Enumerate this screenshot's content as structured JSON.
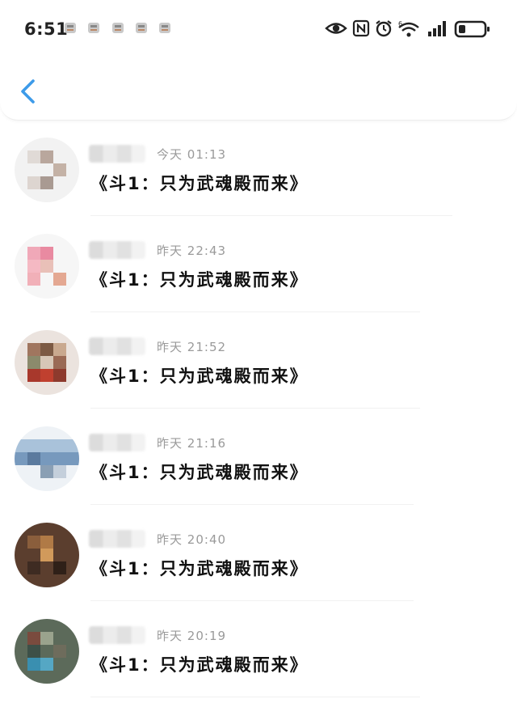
{
  "status_bar": {
    "time": "6:51",
    "notification_icons": [
      "app-icon",
      "app-icon",
      "app-icon",
      "app-icon",
      "app-icon"
    ],
    "system_icons": [
      "eye-icon",
      "nfc-icon",
      "alarm-icon",
      "wifi-6-icon",
      "signal-icon",
      "battery-icon"
    ]
  },
  "header": {
    "back_icon": "chevron-left-icon"
  },
  "messages": [
    {
      "date": "今天",
      "time": "01:13",
      "text": "《斗1：只为武魂殿而来》"
    },
    {
      "date": "昨天",
      "time": "22:43",
      "text": "《斗1：只为武魂殿而来》"
    },
    {
      "date": "昨天",
      "time": "21:52",
      "text": "《斗1：只为武魂殿而来》"
    },
    {
      "date": "昨天",
      "time": "21:16",
      "text": "《斗1：只为武魂殿而来》"
    },
    {
      "date": "昨天",
      "time": "20:40",
      "text": "《斗1：只为武魂殿而来》"
    },
    {
      "date": "昨天",
      "time": "20:19",
      "text": "《斗1：只为武魂殿而来》"
    }
  ],
  "colors": {
    "accent": "#3d9be9",
    "timestamp": "#9a9a9a",
    "text": "#111111"
  }
}
